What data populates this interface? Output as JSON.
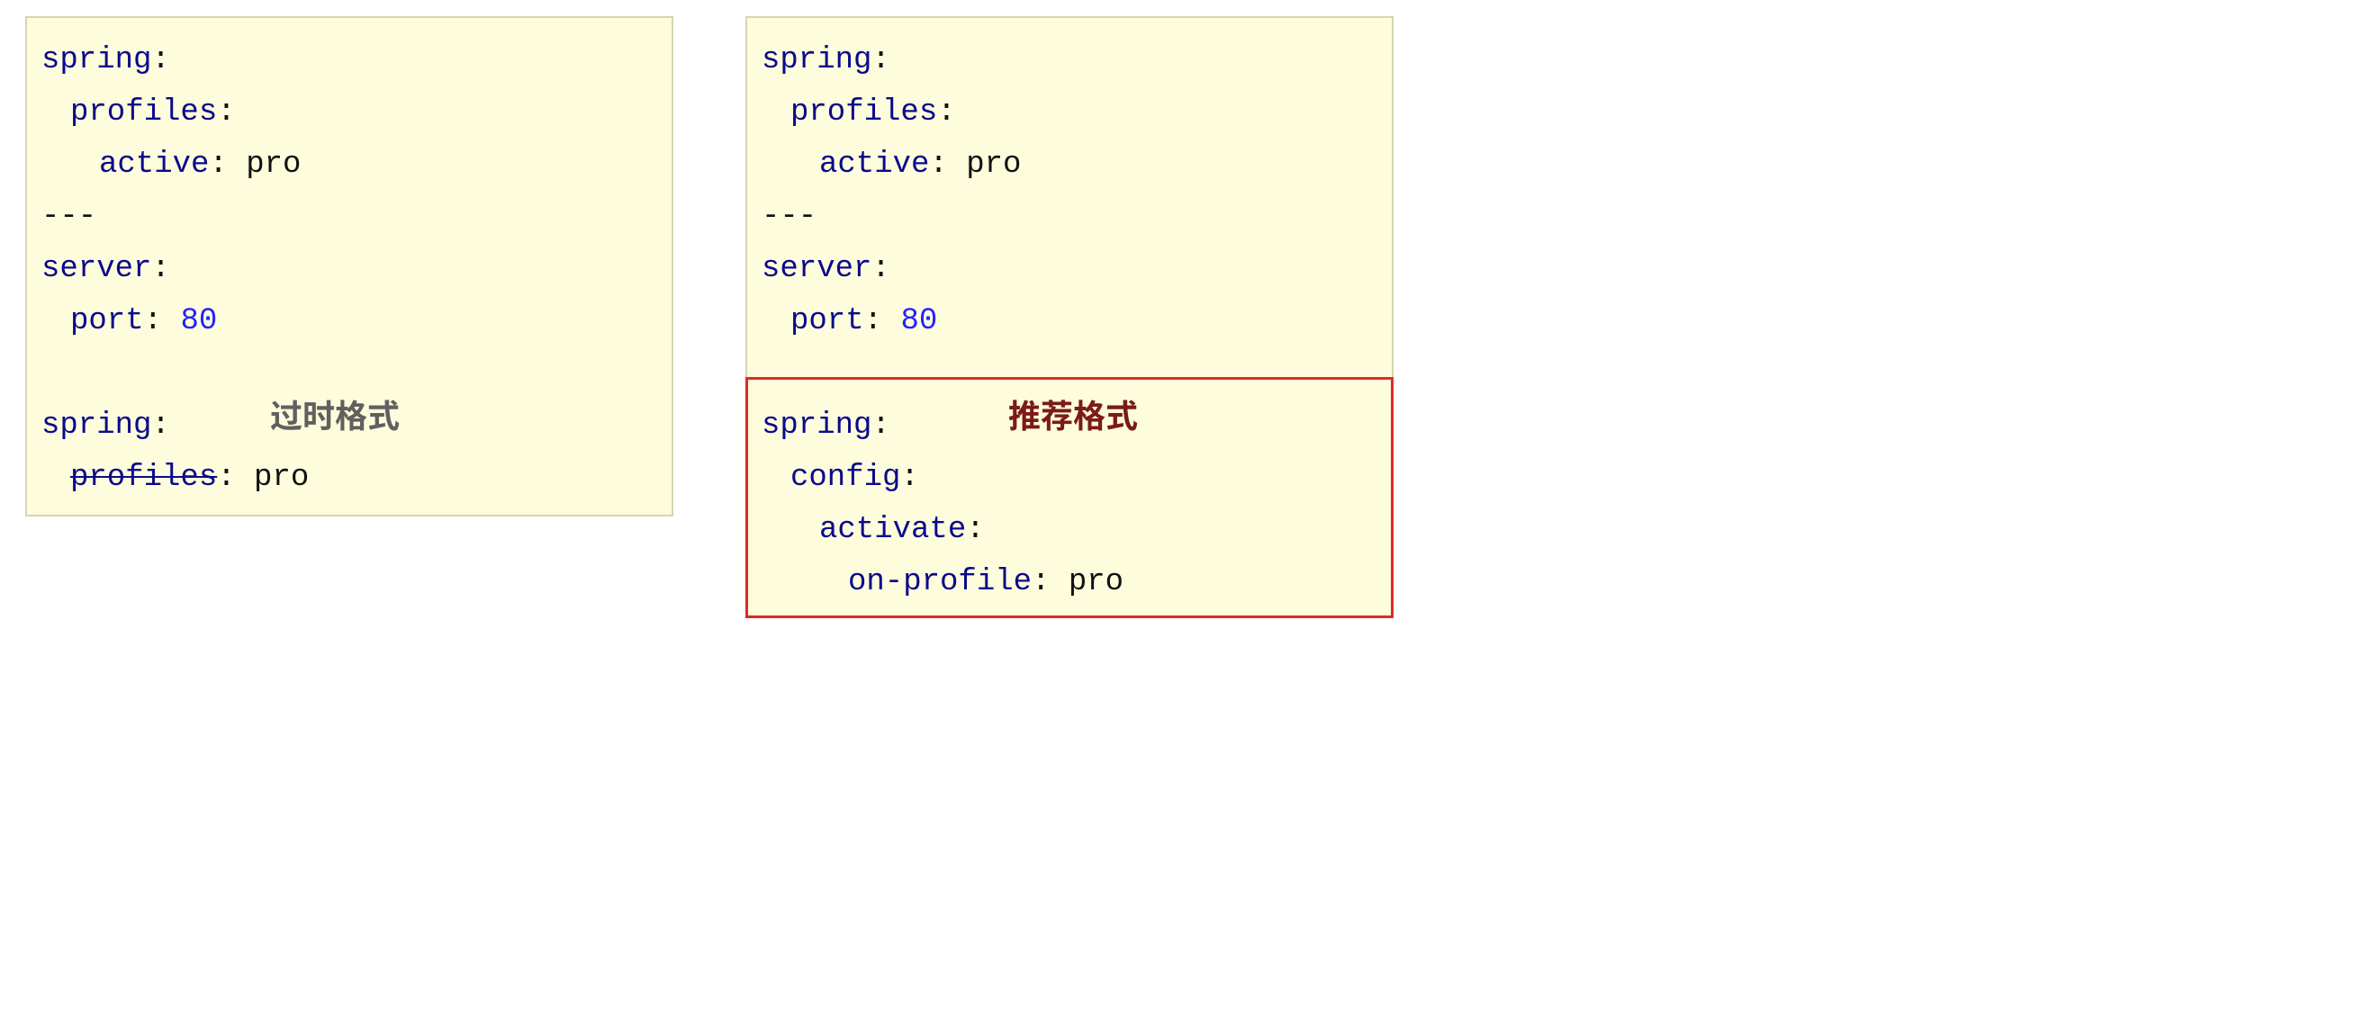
{
  "left": {
    "line1_spring": "spring",
    "line2_profiles": "profiles",
    "line3_active": "active",
    "line3_value": "pro",
    "line4_sep": "---",
    "line5_server": "server",
    "line6_port": "port",
    "line6_value": "80",
    "line8_spring": "spring",
    "line9_profiles_strike": "profiles",
    "line9_value": "pro",
    "annotation": "过时格式"
  },
  "right": {
    "line1_spring": "spring",
    "line2_profiles": "profiles",
    "line3_active": "active",
    "line3_value": "pro",
    "line4_sep": "---",
    "line5_server": "server",
    "line6_port": "port",
    "line6_value": "80",
    "line8_spring": "spring",
    "line9_config": "config",
    "line10_activate": "activate",
    "line11_onprofile": "on-profile",
    "line11_value": "pro",
    "annotation": "推荐格式"
  }
}
